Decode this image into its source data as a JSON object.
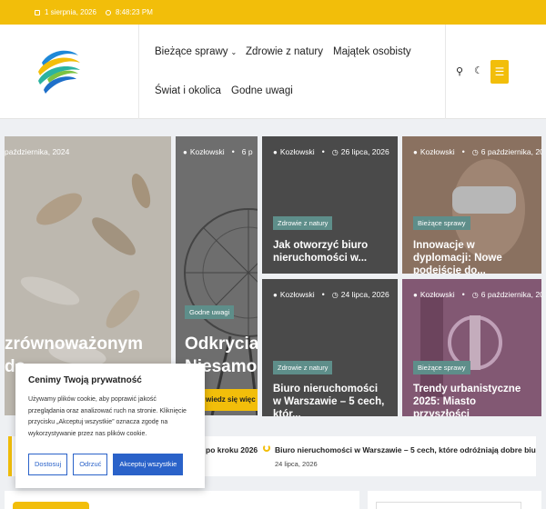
{
  "topbar": {
    "date": "1 sierpnia, 2026",
    "time": "8:48:23 PM"
  },
  "nav": {
    "items": [
      "Bieżące sprawy",
      "Zdrowie z natury",
      "Majątek osobisty",
      "Świat i okolica",
      "Godne uwagi"
    ]
  },
  "hero": {
    "date": "października, 2024",
    "title_line1": "zrównoważonym",
    "title_line2": "do"
  },
  "feature": {
    "author": "Kozłowski",
    "date_partial": "6 p",
    "category": "Godne uwagi",
    "title_line1": "Odkrycia",
    "title_line2": "Niesamo",
    "readmore": "wiedz się więc"
  },
  "cards": [
    {
      "author": "Kozłowski",
      "date": "26 lipca, 2026",
      "category": "Zdrowie z natury",
      "title": "Jak otworzyć biuro nieruchomości w..."
    },
    {
      "author": "Kozłowski",
      "date": "6 października, 2024",
      "category": "Bieżące sprawy",
      "title": "Innowacje w dyplomacji: Nowe podejście do..."
    },
    {
      "author": "Kozłowski",
      "date": "24 lipca, 2026",
      "category": "Zdrowie z natury",
      "title": "Biuro nieruchomości w Warszawie – 5 cech, któr..."
    },
    {
      "author": "Kozłowski",
      "date": "6 października, 2024",
      "category": "Bieżące sprawy",
      "title": "Trendy urbanistyczne 2025: Miasto przyszłości"
    }
  ],
  "cookie": {
    "title": "Cenimy Twoją prywatność",
    "text": "Używamy plików cookie, aby poprawić jakość przeglądania oraz analizować ruch na stronie. Kliknięcie przycisku „Akceptuj wszystkie” oznacza zgodę na wykorzystywanie przez nas plików cookie.",
    "customize": "Dostosuj",
    "reject": "Odrzuć",
    "accept": "Akceptuj wszystkie"
  },
  "ticker": {
    "item1": "po kroku 2026",
    "item2": "Biuro nieruchomości w Warszawie – 5 cech, które odróżniają dobre biur",
    "item2_date": "24 lipca, 2026"
  },
  "colors": {
    "accent": "#f2be0a",
    "tag": "#5e8e8a",
    "primary": "#2a62c9"
  }
}
